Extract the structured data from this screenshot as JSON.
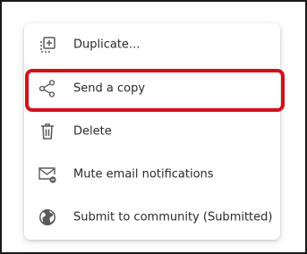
{
  "menu": {
    "items": [
      {
        "label": "Duplicate...",
        "icon": "duplicate-icon"
      },
      {
        "label": "Send a copy",
        "icon": "share-icon",
        "highlighted": true
      },
      {
        "label": "Delete",
        "icon": "trash-icon"
      },
      {
        "label": "Mute email notifications",
        "icon": "mail-mute-icon"
      },
      {
        "label": "Submit to community (Submitted)",
        "icon": "globe-icon"
      }
    ]
  },
  "colors": {
    "highlight": "#d0111b",
    "icon": "#5a5a5a",
    "text": "#2a2a2a"
  }
}
